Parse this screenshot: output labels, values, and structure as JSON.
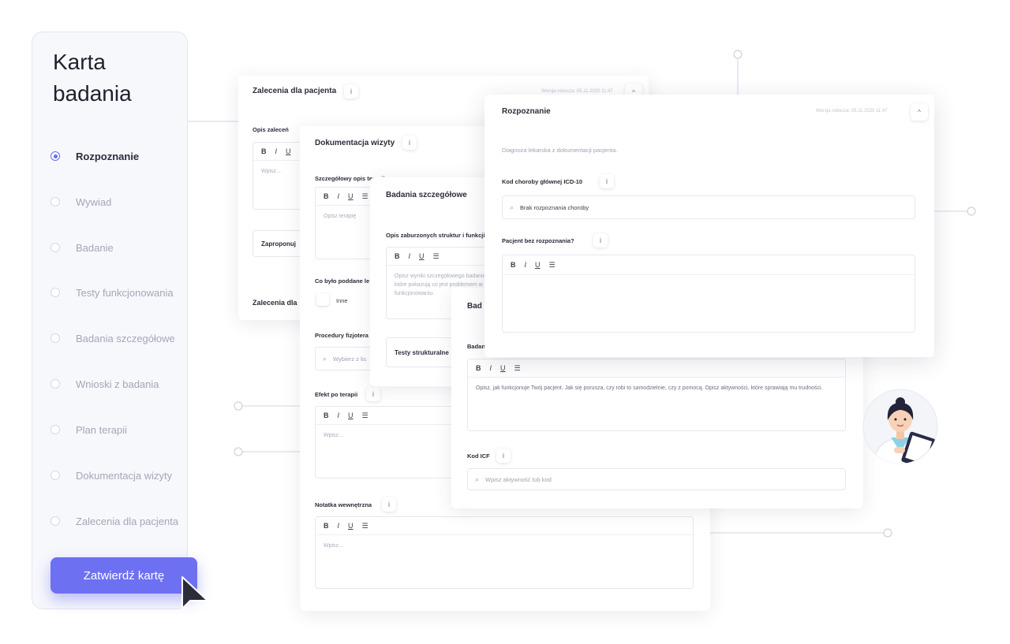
{
  "sidebar": {
    "title": "Karta\nbadania",
    "items": [
      {
        "label": "Rozpoznanie",
        "active": true
      },
      {
        "label": "Wywiad",
        "active": false
      },
      {
        "label": "Badanie",
        "active": false
      },
      {
        "label": "Testy funkcjonowania",
        "active": false
      },
      {
        "label": "Badania szczegółowe",
        "active": false
      },
      {
        "label": "Wnioski z badania",
        "active": false
      },
      {
        "label": "Plan terapii",
        "active": false
      },
      {
        "label": "Dokumentacja wizyty",
        "active": false
      },
      {
        "label": "Zalecenia dla pacjenta",
        "active": false
      }
    ],
    "submit_label": "Zatwierdź kartę"
  },
  "zalecenia": {
    "title": "Zalecenia dla pacjenta",
    "meta": "Wersja robocza: 05.11.2020 11:47",
    "field_label": "Opis zaleceń",
    "placeholder": "Wpisz...",
    "button_label": "Zaproponuj",
    "footer_title": "Zalecenia dla"
  },
  "dokumentacja": {
    "title": "Dokumentacja wizyty",
    "therapy_label": "Szczegółowy opis terapii",
    "therapy_placeholder": "Opisz terapię",
    "subject_label": "Co było poddane le",
    "other_label": "Inne",
    "procedures_label": "Procedury fizjotera",
    "procedures_placeholder": "Wybierz z lis",
    "effect_label": "Efekt po terapii",
    "effect_placeholder": "Wpisz...",
    "note_label": "Notatka wewnętrzna",
    "note_placeholder": "Wpisz..."
  },
  "badania": {
    "title": "Badania szczegółowe",
    "field_label": "Opis zaburzonych struktur i funkcji",
    "placeholder": "Opisz wyniki szczegółowego badania, które pokazują co jest problemem w funkcjonowaniu.",
    "button_label": "Testy strukturalne"
  },
  "badanie_card": {
    "title": "Bad",
    "field_label": "Badan",
    "placeholder": "Opisz, jak funkcjonuje Twój pacjent. Jak się porusza, czy robi to samodzielnie, czy z pomocą. Opisz aktywności, które sprawiają mu trudności.",
    "icf_label": "Kod ICF",
    "icf_placeholder": "Wpisz aktywność lub kod"
  },
  "rozpoznanie": {
    "title": "Rozpoznanie",
    "meta": "Wersja robocza: 05.11.2020 11:47",
    "description": "Diagnoza lekarska z dokumentacji pacjenta.",
    "icd_label": "Kod choroby głównej ICD-10",
    "icd_value": "Brak rozpoznania choroby",
    "no_diagnosis_label": "Pacjent bez rozpoznania?"
  },
  "editor": {
    "bold": "B",
    "italic": "I",
    "underline": "U",
    "list": "☰"
  },
  "icons": {
    "info": "i",
    "collapse": "^",
    "search": "⌕"
  },
  "colors": {
    "accent": "#6e70f2",
    "text": "#2b2d3a",
    "muted": "#a3a7b8"
  }
}
